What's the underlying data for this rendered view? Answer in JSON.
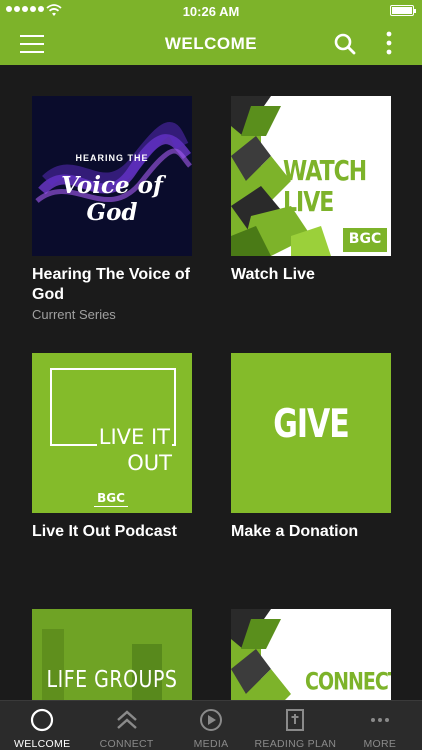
{
  "status_bar": {
    "time": "10:26 AM"
  },
  "header": {
    "title": "WELCOME"
  },
  "cards": [
    {
      "label": "Hearing The Voice of God",
      "subtitle": "Current Series",
      "art": {
        "small_text": "HEARING THE",
        "script_text": "Voice of God"
      }
    },
    {
      "label": "Watch Live",
      "art": {
        "text": "WATCH LIVE",
        "logo": "BGC"
      }
    },
    {
      "label": "Live It Out Podcast",
      "art": {
        "line1": "LIVE IT",
        "line2": "OUT",
        "logo": "BGC"
      }
    },
    {
      "label": "Make a Donation",
      "art": {
        "text": "GIVE"
      }
    },
    {
      "label": "",
      "art": {
        "text": "LIFE GROUPS"
      }
    },
    {
      "label": "",
      "art": {
        "text": "CONNECT"
      }
    }
  ],
  "tabs": [
    {
      "label": "WELCOME",
      "icon": "circle-icon",
      "active": true
    },
    {
      "label": "CONNECT",
      "icon": "double-chevron-up-icon",
      "active": false
    },
    {
      "label": "MEDIA",
      "icon": "play-circle-icon",
      "active": false
    },
    {
      "label": "READING PLAN",
      "icon": "bible-icon",
      "active": false
    },
    {
      "label": "MORE",
      "icon": "more-dots-icon",
      "active": false
    }
  ],
  "colors": {
    "brand_green": "#7db32a",
    "background": "#1b1b1b",
    "tab_bar": "#2b2b2b"
  }
}
